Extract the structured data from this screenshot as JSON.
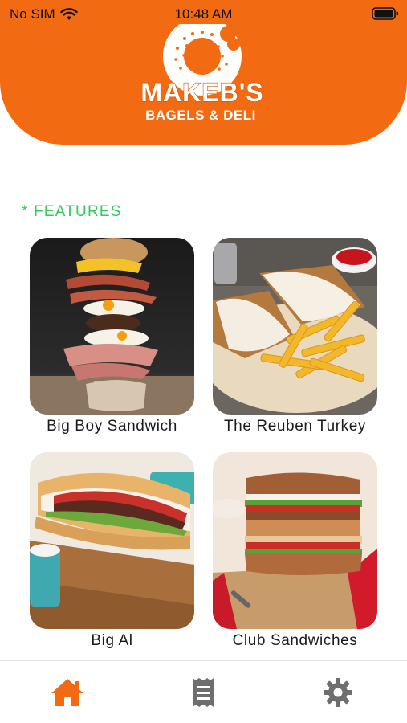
{
  "status_bar": {
    "carrier": "No SIM",
    "time": "10:48 AM"
  },
  "header": {
    "brand_line1": "MAKEB'S",
    "brand_line2": "BAGELS & DELI",
    "brand_color": "#f26a12"
  },
  "features": {
    "section_label": "* FEATURES",
    "accent_color": "#35c759",
    "items": [
      {
        "label": "Big Boy Sandwich"
      },
      {
        "label": "The Reuben Turkey"
      },
      {
        "label": "Big Al"
      },
      {
        "label": "Club Sandwiches"
      }
    ]
  },
  "tabbar": {
    "tabs": [
      {
        "icon": "home-icon",
        "active": true
      },
      {
        "icon": "receipt-icon",
        "active": false
      },
      {
        "icon": "gear-icon",
        "active": false
      }
    ],
    "active_color": "#f26a12",
    "inactive_color": "#6e6e6e"
  }
}
